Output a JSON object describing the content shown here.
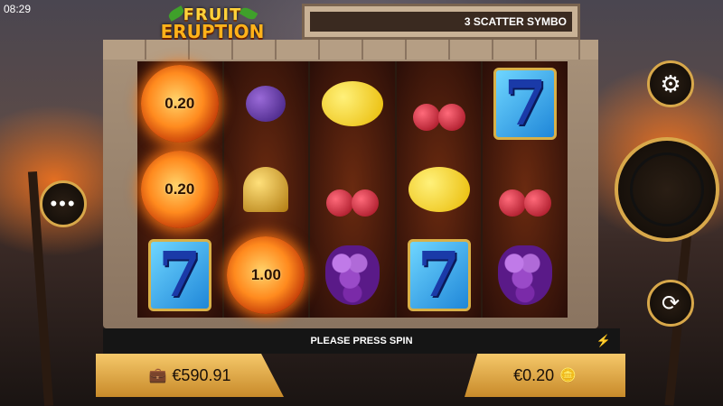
{
  "status_bar": {
    "time": "08:29"
  },
  "logo": {
    "line1": "FRUIT",
    "line2": "ERUPTION"
  },
  "banner": {
    "text": "3 SCATTER SYMBO"
  },
  "reels": [
    [
      {
        "type": "sun",
        "value": "0.20"
      },
      {
        "type": "sun",
        "value": "0.20"
      },
      {
        "type": "seven",
        "value": "7"
      }
    ],
    [
      {
        "type": "plum"
      },
      {
        "type": "bell"
      },
      {
        "type": "sun",
        "value": "1.00"
      }
    ],
    [
      {
        "type": "lemon"
      },
      {
        "type": "cherry"
      },
      {
        "type": "grapes"
      }
    ],
    [
      {
        "type": "cherry"
      },
      {
        "type": "lemon"
      },
      {
        "type": "seven",
        "value": "7"
      }
    ],
    [
      {
        "type": "seven",
        "value": "7"
      },
      {
        "type": "cherry"
      },
      {
        "type": "grapes"
      }
    ]
  ],
  "message": "PLEASE PRESS SPIN",
  "balance": {
    "icon": "briefcase-icon",
    "value": "€590.91"
  },
  "bet": {
    "value": "€0.20",
    "icon": "coins-icon"
  },
  "buttons": {
    "settings_icon": "gear-icon",
    "spin_icon": "spin-arrow-icon",
    "autoplay_icon": "autoplay-icon",
    "menu_icon": "more-dots-icon",
    "menu_label": "•••",
    "bolt_icon": "turbo-bolt-icon"
  },
  "colors": {
    "gold": "#d8a84a",
    "accent": "#ffb21a"
  }
}
